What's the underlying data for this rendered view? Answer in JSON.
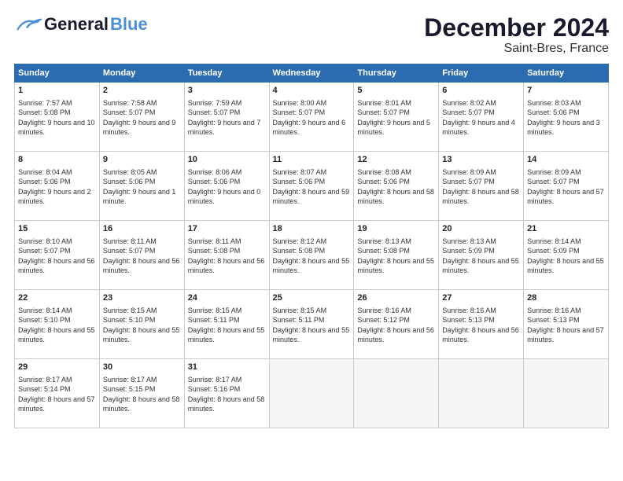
{
  "logo": {
    "general": "General",
    "blue": "Blue"
  },
  "title": "December 2024",
  "subtitle": "Saint-Bres, France",
  "days_header": [
    "Sunday",
    "Monday",
    "Tuesday",
    "Wednesday",
    "Thursday",
    "Friday",
    "Saturday"
  ],
  "weeks": [
    [
      {
        "day": "1",
        "sunrise": "7:57 AM",
        "sunset": "5:08 PM",
        "daylight": "9 hours and 10 minutes."
      },
      {
        "day": "2",
        "sunrise": "7:58 AM",
        "sunset": "5:07 PM",
        "daylight": "9 hours and 9 minutes."
      },
      {
        "day": "3",
        "sunrise": "7:59 AM",
        "sunset": "5:07 PM",
        "daylight": "9 hours and 7 minutes."
      },
      {
        "day": "4",
        "sunrise": "8:00 AM",
        "sunset": "5:07 PM",
        "daylight": "9 hours and 6 minutes."
      },
      {
        "day": "5",
        "sunrise": "8:01 AM",
        "sunset": "5:07 PM",
        "daylight": "9 hours and 5 minutes."
      },
      {
        "day": "6",
        "sunrise": "8:02 AM",
        "sunset": "5:07 PM",
        "daylight": "9 hours and 4 minutes."
      },
      {
        "day": "7",
        "sunrise": "8:03 AM",
        "sunset": "5:06 PM",
        "daylight": "9 hours and 3 minutes."
      }
    ],
    [
      {
        "day": "8",
        "sunrise": "8:04 AM",
        "sunset": "5:06 PM",
        "daylight": "9 hours and 2 minutes."
      },
      {
        "day": "9",
        "sunrise": "8:05 AM",
        "sunset": "5:06 PM",
        "daylight": "9 hours and 1 minute."
      },
      {
        "day": "10",
        "sunrise": "8:06 AM",
        "sunset": "5:06 PM",
        "daylight": "9 hours and 0 minutes."
      },
      {
        "day": "11",
        "sunrise": "8:07 AM",
        "sunset": "5:06 PM",
        "daylight": "8 hours and 59 minutes."
      },
      {
        "day": "12",
        "sunrise": "8:08 AM",
        "sunset": "5:06 PM",
        "daylight": "8 hours and 58 minutes."
      },
      {
        "day": "13",
        "sunrise": "8:09 AM",
        "sunset": "5:07 PM",
        "daylight": "8 hours and 58 minutes."
      },
      {
        "day": "14",
        "sunrise": "8:09 AM",
        "sunset": "5:07 PM",
        "daylight": "8 hours and 57 minutes."
      }
    ],
    [
      {
        "day": "15",
        "sunrise": "8:10 AM",
        "sunset": "5:07 PM",
        "daylight": "8 hours and 56 minutes."
      },
      {
        "day": "16",
        "sunrise": "8:11 AM",
        "sunset": "5:07 PM",
        "daylight": "8 hours and 56 minutes."
      },
      {
        "day": "17",
        "sunrise": "8:11 AM",
        "sunset": "5:08 PM",
        "daylight": "8 hours and 56 minutes."
      },
      {
        "day": "18",
        "sunrise": "8:12 AM",
        "sunset": "5:08 PM",
        "daylight": "8 hours and 55 minutes."
      },
      {
        "day": "19",
        "sunrise": "8:13 AM",
        "sunset": "5:08 PM",
        "daylight": "8 hours and 55 minutes."
      },
      {
        "day": "20",
        "sunrise": "8:13 AM",
        "sunset": "5:09 PM",
        "daylight": "8 hours and 55 minutes."
      },
      {
        "day": "21",
        "sunrise": "8:14 AM",
        "sunset": "5:09 PM",
        "daylight": "8 hours and 55 minutes."
      }
    ],
    [
      {
        "day": "22",
        "sunrise": "8:14 AM",
        "sunset": "5:10 PM",
        "daylight": "8 hours and 55 minutes."
      },
      {
        "day": "23",
        "sunrise": "8:15 AM",
        "sunset": "5:10 PM",
        "daylight": "8 hours and 55 minutes."
      },
      {
        "day": "24",
        "sunrise": "8:15 AM",
        "sunset": "5:11 PM",
        "daylight": "8 hours and 55 minutes."
      },
      {
        "day": "25",
        "sunrise": "8:15 AM",
        "sunset": "5:11 PM",
        "daylight": "8 hours and 55 minutes."
      },
      {
        "day": "26",
        "sunrise": "8:16 AM",
        "sunset": "5:12 PM",
        "daylight": "8 hours and 56 minutes."
      },
      {
        "day": "27",
        "sunrise": "8:16 AM",
        "sunset": "5:13 PM",
        "daylight": "8 hours and 56 minutes."
      },
      {
        "day": "28",
        "sunrise": "8:16 AM",
        "sunset": "5:13 PM",
        "daylight": "8 hours and 57 minutes."
      }
    ],
    [
      {
        "day": "29",
        "sunrise": "8:17 AM",
        "sunset": "5:14 PM",
        "daylight": "8 hours and 57 minutes."
      },
      {
        "day": "30",
        "sunrise": "8:17 AM",
        "sunset": "5:15 PM",
        "daylight": "8 hours and 58 minutes."
      },
      {
        "day": "31",
        "sunrise": "8:17 AM",
        "sunset": "5:16 PM",
        "daylight": "8 hours and 58 minutes."
      },
      null,
      null,
      null,
      null
    ]
  ]
}
